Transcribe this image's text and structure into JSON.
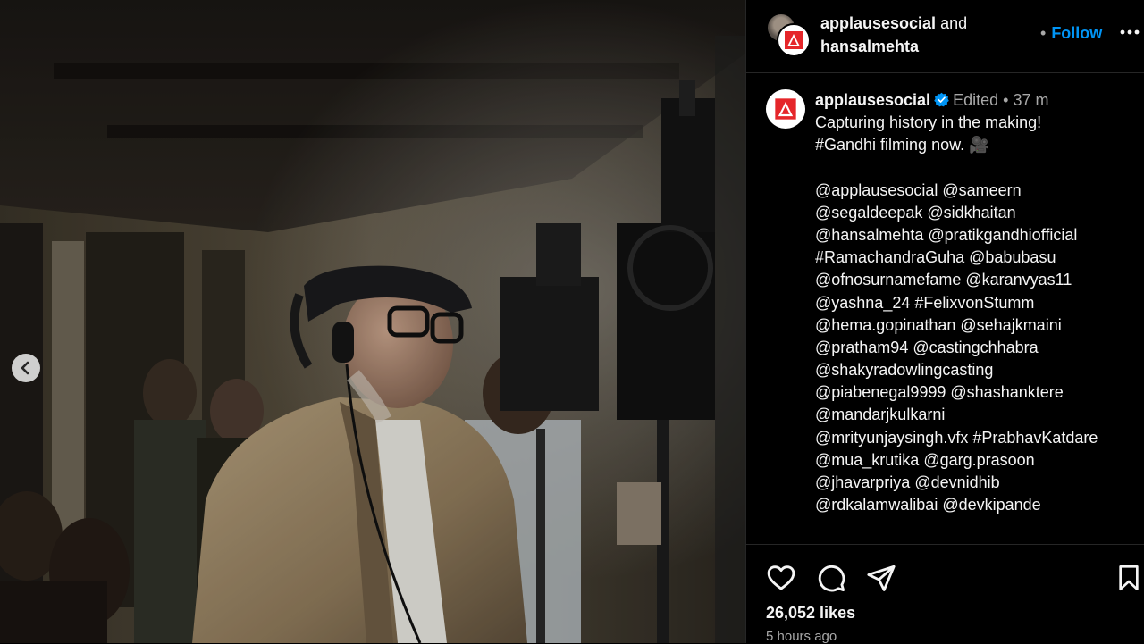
{
  "header": {
    "user1": "applausesocial",
    "connector": "and",
    "user2": "hansalmehta",
    "separator": "•",
    "follow_label": "Follow",
    "more_icon": "more-horizontal-icon"
  },
  "post": {
    "username": "applausesocial",
    "edited": "Edited",
    "dot": "•",
    "age": "37 m",
    "caption_lines": [
      "Capturing history in the making!",
      "#Gandhi filming now. 🎥",
      "",
      "@applausesocial @sameern",
      "@segaldeepak @sidkhaitan",
      "@hansalmehta @pratikgandhiofficial",
      "#RamachandraGuha @babubasu",
      "@ofnosurnamefame @karanvyas11",
      "@yashna_24 #FelixvonStumm",
      "@hema.gopinathan @sehajkmaini",
      "@pratham94 @castingchhabra",
      "@shakyradowlingcasting",
      "@piabenegal9999 @shashanktere",
      "@mandarjkulkarni",
      "@mrityunjaysingh.vfx #PrabhavKatdare",
      "@mua_krutika @garg.prasoon",
      "@jhavarpriya @devnidhib",
      "@rdkalamwalibai @devkipande"
    ]
  },
  "actions": {
    "like_icon": "heart-icon",
    "comment_icon": "comment-icon",
    "share_icon": "send-icon",
    "save_icon": "bookmark-icon",
    "likes": "26,052 likes",
    "time": "5 hours ago"
  },
  "colors": {
    "accent": "#0095f6",
    "logo_red": "#e5262a",
    "panel_bg": "#000000",
    "muted": "#a8a8a8"
  }
}
